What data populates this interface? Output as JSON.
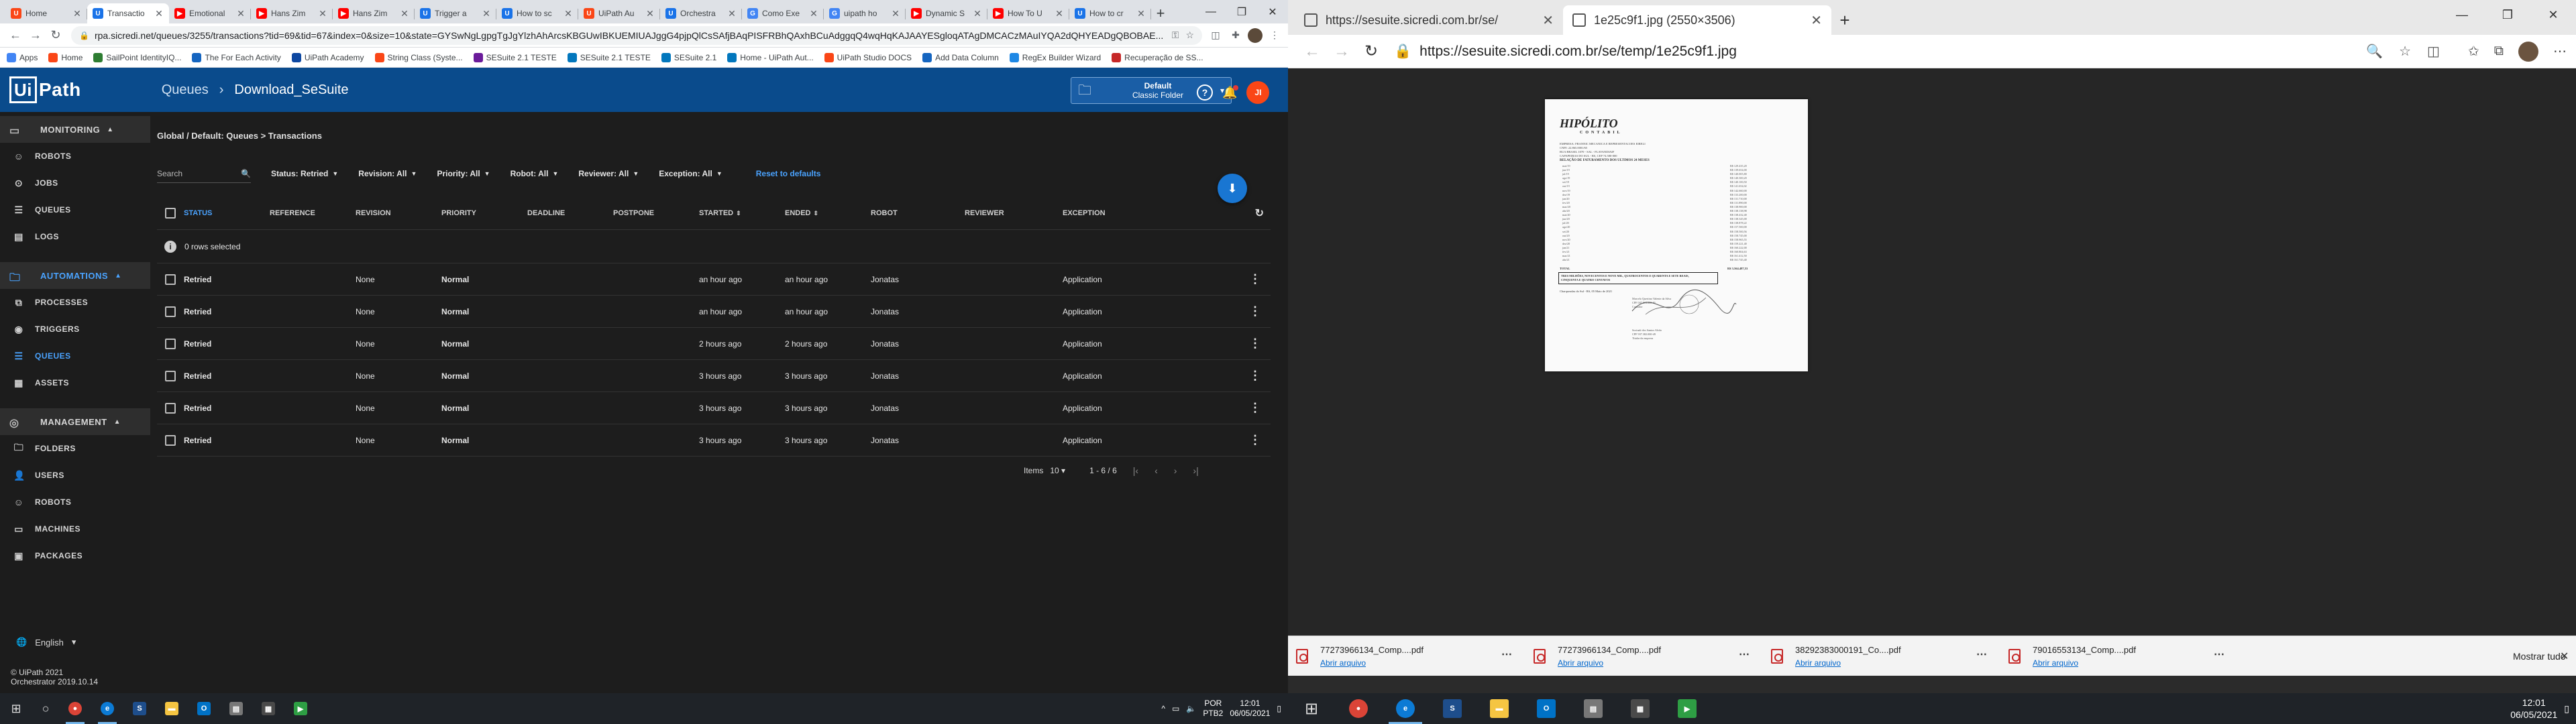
{
  "left_browser": {
    "tabs": [
      {
        "label": "Home",
        "color": "#fa4616",
        "glyph": "U"
      },
      {
        "label": "Transactio",
        "color": "#1a73e8",
        "glyph": "U",
        "active": true
      },
      {
        "label": "Emotional",
        "color": "#ff0000",
        "glyph": "▶"
      },
      {
        "label": "Hans Zim",
        "color": "#ff0000",
        "glyph": "▶"
      },
      {
        "label": "Hans Zim",
        "color": "#ff0000",
        "glyph": "▶"
      },
      {
        "label": "Trigger a",
        "color": "#1a73e8",
        "glyph": "U"
      },
      {
        "label": "How to sc",
        "color": "#1a73e8",
        "glyph": "U"
      },
      {
        "label": "UiPath Au",
        "color": "#fa4616",
        "glyph": "U"
      },
      {
        "label": "Orchestra",
        "color": "#1a73e8",
        "glyph": "U"
      },
      {
        "label": "Como Exe",
        "color": "#4285f4",
        "glyph": "G"
      },
      {
        "label": "uipath ho",
        "color": "#4285f4",
        "glyph": "G"
      },
      {
        "label": "Dynamic S",
        "color": "#ff0000",
        "glyph": "▶"
      },
      {
        "label": "How To U",
        "color": "#ff0000",
        "glyph": "▶"
      },
      {
        "label": "How to cr",
        "color": "#1a73e8",
        "glyph": "U"
      }
    ],
    "url": "rpa.sicredi.net/queues/3255/transactions?tid=69&tid=67&index=0&size=10&state=GYSwNgLgpgTgJgYlzhAhArcsKBGUwIBKUEMIUAJggG4pjpQlCsSAfjBAqPISFRBhQAxhBCuAdggqQ4wqHqKAJAAYESgloqATAgDMCACzMAuIYQA2dQHYEADgQBOBAE...",
    "bookmarks": [
      "Apps",
      "Home",
      "SailPoint IdentityIQ...",
      "The For Each Activity",
      "UiPath Academy",
      "String Class (Syste...",
      "SESuite 2.1 TESTE",
      "SESuite 2.1 TESTE",
      "SESuite 2.1",
      "Home - UiPath Aut...",
      "UiPath Studio DOCS",
      "Add Data Column",
      "RegEx Builder Wizard",
      "Recuperação de SS..."
    ]
  },
  "uipath": {
    "logo": "UiPath",
    "header_section": "Queues",
    "header_sep": "›",
    "header_queue": "Download_SeSuite",
    "folder_label_1": "Default",
    "folder_label_2": "Classic Folder",
    "user_initials": "JI",
    "help_glyph": "?",
    "sidebar": {
      "groups": [
        {
          "label": "MONITORING",
          "items": [
            "ROBOTS",
            "JOBS",
            "QUEUES",
            "LOGS"
          ]
        },
        {
          "label": "AUTOMATIONS",
          "items": [
            "PROCESSES",
            "TRIGGERS",
            "QUEUES",
            "ASSETS"
          ]
        },
        {
          "label": "MANAGEMENT",
          "items": [
            "FOLDERS",
            "USERS",
            "ROBOTS",
            "MACHINES",
            "PACKAGES"
          ]
        }
      ],
      "language": "English",
      "copyright": "© UiPath 2021",
      "version": "Orchestrator 2019.10.14"
    },
    "breadcrumb": "Global / Default: Queues > Transactions",
    "filters": {
      "search_placeholder": "Search",
      "status": "Status: Retried",
      "revision": "Revision: All",
      "priority": "Priority: All",
      "robot": "Robot: All",
      "reviewer": "Reviewer: All",
      "exception": "Exception: All",
      "reset": "Reset to defaults"
    },
    "columns": [
      "STATUS",
      "REFERENCE",
      "REVISION",
      "PRIORITY",
      "DEADLINE",
      "POSTPONE",
      "STARTED",
      "ENDED",
      "ROBOT",
      "REVIEWER",
      "EXCEPTION"
    ],
    "selection_text": "0 rows selected",
    "rows": [
      {
        "status": "Retried",
        "reference": "",
        "revision": "None",
        "priority": "Normal",
        "deadline": "",
        "postpone": "",
        "started": "an hour ago",
        "ended": "an hour ago",
        "robot": "Jonatas",
        "reviewer": "",
        "exception": "Application"
      },
      {
        "status": "Retried",
        "reference": "",
        "revision": "None",
        "priority": "Normal",
        "deadline": "",
        "postpone": "",
        "started": "an hour ago",
        "ended": "an hour ago",
        "robot": "Jonatas",
        "reviewer": "",
        "exception": "Application"
      },
      {
        "status": "Retried",
        "reference": "",
        "revision": "None",
        "priority": "Normal",
        "deadline": "",
        "postpone": "",
        "started": "2 hours ago",
        "ended": "2 hours ago",
        "robot": "Jonatas",
        "reviewer": "",
        "exception": "Application"
      },
      {
        "status": "Retried",
        "reference": "",
        "revision": "None",
        "priority": "Normal",
        "deadline": "",
        "postpone": "",
        "started": "3 hours ago",
        "ended": "3 hours ago",
        "robot": "Jonatas",
        "reviewer": "",
        "exception": "Application"
      },
      {
        "status": "Retried",
        "reference": "",
        "revision": "None",
        "priority": "Normal",
        "deadline": "",
        "postpone": "",
        "started": "3 hours ago",
        "ended": "3 hours ago",
        "robot": "Jonatas",
        "reviewer": "",
        "exception": "Application"
      },
      {
        "status": "Retried",
        "reference": "",
        "revision": "None",
        "priority": "Normal",
        "deadline": "",
        "postpone": "",
        "started": "3 hours ago",
        "ended": "3 hours ago",
        "robot": "Jonatas",
        "reviewer": "",
        "exception": "Application"
      }
    ],
    "pager": {
      "items_label": "Items",
      "page_size": "10",
      "range": "1 - 6 / 6"
    }
  },
  "right_browser": {
    "tabs": [
      {
        "label": "https://sesuite.sicredi.com.br/se/"
      },
      {
        "label": "1e25c9f1.jpg (2550×3506)",
        "active": true
      }
    ],
    "url": "https://sesuite.sicredi.com.br/se/temp/1e25c9f1.jpg",
    "document": {
      "logo": "HIPÓLITO",
      "logo_sub": "CONTABIL",
      "header_lines": [
        "EMPRESA: FRANNIC MECANICA E REPRESENTACOES EIRELI",
        "CNPJ: 22.865.0001/65",
        "RUA BRASIL 1070 - SAL - FLAVANDIAIF",
        "CAPAPEIRAS DO SUL - RS, CEP 74.580-000"
      ],
      "relation_title": "RELAÇÃO DE FATURAMENTO DOS ULTIMOS 24 MESES",
      "months": [
        "mai/19",
        "jun/19",
        "jul/19",
        "ago/19",
        "set/19",
        "out/19",
        "nov/19",
        "dez/19",
        "jan/20",
        "fev/20",
        "mar/20",
        "abr/20",
        "mai/20",
        "jun/20",
        "jul/20",
        "ago/20",
        "set/20",
        "out/20",
        "nov/20",
        "dez/20",
        "jan/21",
        "fev/21",
        "mar/21",
        "abr/21"
      ],
      "amounts": [
        "R$ 129.435,20",
        "R$ 139.654,00",
        "R$ 140.005,80",
        "R$ 140.300,20",
        "R$ 140.100,50",
        "R$ 141.654,02",
        "R$ 142.660,00",
        "R$ 133.200,00",
        "R$ 131.710,00",
        "R$ 131.890,00",
        "R$ 138.900,00",
        "R$ 138.138,98",
        "R$ 138.432,40",
        "R$ 138.345,00",
        "R$ 138.878,22",
        "R$ 157.500,00",
        "R$ 158.500,56",
        "R$ 158.745,00",
        "R$ 158.965,55",
        "R$ 159.221,40",
        "R$ 160.222,00",
        "R$ 160.804,63",
        "R$ 161.412,50",
        "R$ 161.745,40"
      ],
      "total_label": "TOTAL",
      "total_value": "R$ 3.564.487,53",
      "extenso_1": "TRES MILHÕES, NOVECENTOS E NOVE MIL, QUATROCENTOS E QUARENTA E SETE REAIS,",
      "extenso_2": "CINQUENTA E QUATRO CENTAVOS",
      "local": "Charqueadas do Sul - RS, 05 Maio de 2021",
      "sig_1": [
        "Marcelo Quertino Valente da Silva",
        "CPF 047.913.000-01",
        "Contador"
      ],
      "sig_2": [
        "Socinalr dos Santos Alvão",
        "CPF 937.382.000-49",
        "Titular da empresa"
      ]
    },
    "downloads": [
      {
        "name": "77273966134_Comp....pdf",
        "action": "Abrir arquivo"
      },
      {
        "name": "77273966134_Comp....pdf",
        "action": "Abrir arquivo"
      },
      {
        "name": "38292383000191_Co....pdf",
        "action": "Abrir arquivo"
      },
      {
        "name": "79016553134_Comp....pdf",
        "action": "Abrir arquivo"
      }
    ],
    "show_all": "Mostrar tudo"
  },
  "taskbar_left": {
    "lang": "POR",
    "layout": "PTB2",
    "time": "12:01",
    "date": "06/05/2021"
  },
  "taskbar_right": {
    "time": "12:01",
    "date": "06/05/2021"
  }
}
